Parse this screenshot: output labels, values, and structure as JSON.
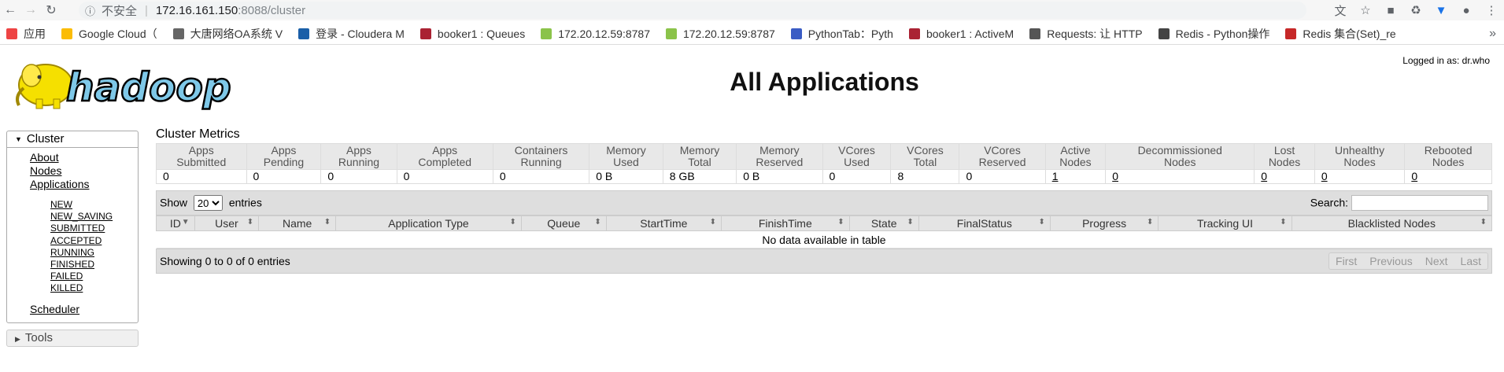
{
  "browser": {
    "insecure_label": "不安全",
    "host": "172.16.161.150",
    "path": ":8088/cluster",
    "bookmarks": [
      {
        "label": "应用",
        "color": "#e44"
      },
      {
        "label": "Google Cloud（",
        "color": "#fbbc05"
      },
      {
        "label": "大唐网络OA系统 V",
        "color": "#666"
      },
      {
        "label": "登录 - Cloudera M",
        "color": "#1a5fa8"
      },
      {
        "label": "booker1 : Queues",
        "color": "#a23"
      },
      {
        "label": "172.20.12.59:8787",
        "color": "#8bc34a"
      },
      {
        "label": "172.20.12.59:8787",
        "color": "#8bc34a"
      },
      {
        "label": "PythonTab：Pyth",
        "color": "#3a5cc4"
      },
      {
        "label": "booker1 : ActiveM",
        "color": "#a23"
      },
      {
        "label": "Requests: 让 HTTP",
        "color": "#555"
      },
      {
        "label": "Redis - Python操作",
        "color": "#444"
      },
      {
        "label": "Redis 集合(Set)_re",
        "color": "#c62828"
      }
    ]
  },
  "page": {
    "title": "All Applications",
    "logged_in": "Logged in as: dr.who",
    "logo_text": "hadoop"
  },
  "nav": {
    "cluster_label": "Cluster",
    "links": [
      "About",
      "Nodes",
      "Applications"
    ],
    "states": [
      "NEW",
      "NEW_SAVING",
      "SUBMITTED",
      "ACCEPTED",
      "RUNNING",
      "FINISHED",
      "FAILED",
      "KILLED"
    ],
    "scheduler": "Scheduler",
    "tools_label": "Tools"
  },
  "metrics": {
    "title": "Cluster Metrics",
    "headers": [
      [
        "Apps",
        "Submitted"
      ],
      [
        "Apps",
        "Pending"
      ],
      [
        "Apps",
        "Running"
      ],
      [
        "Apps",
        "Completed"
      ],
      [
        "Containers",
        "Running"
      ],
      [
        "Memory",
        "Used"
      ],
      [
        "Memory",
        "Total"
      ],
      [
        "Memory",
        "Reserved"
      ],
      [
        "VCores",
        "Used"
      ],
      [
        "VCores",
        "Total"
      ],
      [
        "VCores",
        "Reserved"
      ],
      [
        "Active",
        "Nodes"
      ],
      [
        "Decommissioned",
        "Nodes"
      ],
      [
        "Lost",
        "Nodes"
      ],
      [
        "Unhealthy",
        "Nodes"
      ],
      [
        "Rebooted",
        "Nodes"
      ]
    ],
    "values": [
      "0",
      "0",
      "0",
      "0",
      "0",
      "0 B",
      "8 GB",
      "0 B",
      "0",
      "8",
      "0",
      "1",
      "0",
      "0",
      "0",
      "0"
    ]
  },
  "apps_table": {
    "show_label": "Show",
    "entries_count": "20",
    "entries_label": "entries",
    "search_label": "Search:",
    "columns": [
      "ID",
      "User",
      "Name",
      "Application Type",
      "Queue",
      "StartTime",
      "FinishTime",
      "State",
      "FinalStatus",
      "Progress",
      "Tracking UI",
      "Blacklisted Nodes"
    ],
    "empty_message": "No data available in table",
    "footer_info": "Showing 0 to 0 of 0 entries",
    "pager": [
      "First",
      "Previous",
      "Next",
      "Last"
    ]
  }
}
